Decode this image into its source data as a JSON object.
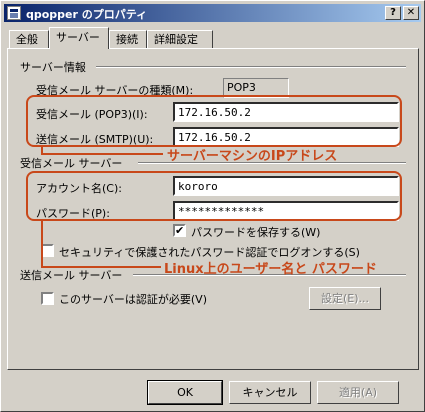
{
  "window": {
    "title": "qpopper のプロパティ",
    "controls": {
      "help": "?",
      "close": "✕"
    }
  },
  "tabs": [
    "全般",
    "サーバー",
    "接続",
    "詳細設定"
  ],
  "server_info": {
    "group_label": "サーバー情報",
    "type_label": "受信メール サーバーの種類(M):",
    "type_value": "POP3",
    "incoming_label": "受信メール (POP3)(I):",
    "incoming_value": "172.16.50.2",
    "outgoing_label": "送信メール (SMTP)(U):",
    "outgoing_value": "172.16.50.2"
  },
  "incoming_server": {
    "group_label": "受信メール サーバー",
    "account_label": "アカウント名(C):",
    "account_value": "kororo",
    "password_label": "パスワード(P):",
    "password_value": "*************",
    "remember_label": "パスワードを保存する(W)",
    "remember_checked": true,
    "spa_label": "セキュリティで保護されたパスワード認証でログオンする(S)",
    "spa_checked": false
  },
  "outgoing_server": {
    "group_label": "送信メール サーバー",
    "auth_label": "このサーバーは認証が必要(V)",
    "auth_checked": false,
    "settings_button": "設定(E)..."
  },
  "buttons": {
    "ok": "OK",
    "cancel": "キャンセル",
    "apply": "適用(A)"
  },
  "annotations": {
    "ip_note": "サーバーマシンのIPアドレス",
    "user_note": "Linux上のユーザー名と パスワード",
    "color": "#c8481a"
  }
}
